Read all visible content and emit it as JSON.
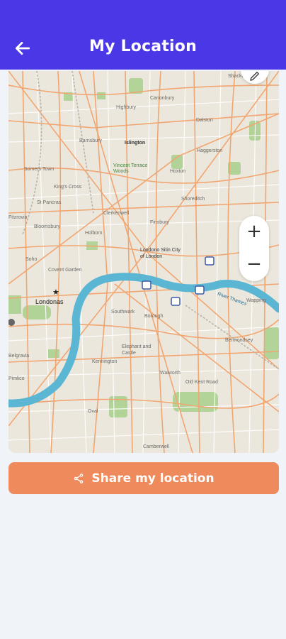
{
  "app_bar": {
    "title": "My Location",
    "back_icon": "arrow-left-icon",
    "background": "#4a38e6"
  },
  "map": {
    "place_labels": [
      {
        "id": "shacklewell",
        "text": "Shacklewell"
      },
      {
        "id": "highbury",
        "text": "Highbury"
      },
      {
        "id": "canonbury",
        "text": "Canonbury"
      },
      {
        "id": "dalston",
        "text": "Dalston"
      },
      {
        "id": "barnsbury",
        "text": "Barnsbury"
      },
      {
        "id": "islington",
        "text": "Islington"
      },
      {
        "id": "haggerston",
        "text": "Haggerston"
      },
      {
        "id": "somers-town",
        "text": "Somers Town"
      },
      {
        "id": "vincent-terrace",
        "text": "Vincent Terrace Woods"
      },
      {
        "id": "hoxton",
        "text": "Hoxton"
      },
      {
        "id": "kings-cross",
        "text": "King's Cross"
      },
      {
        "id": "st-pancras",
        "text": "St Pancras"
      },
      {
        "id": "clerkenwell",
        "text": "Clerkenwell"
      },
      {
        "id": "shoreditch",
        "text": "Shoreditch"
      },
      {
        "id": "fitzrovia",
        "text": "Fitzrovia"
      },
      {
        "id": "bloomsbury",
        "text": "Bloomsbury"
      },
      {
        "id": "finsbury",
        "text": "Finsbury"
      },
      {
        "id": "holborn",
        "text": "Holborn"
      },
      {
        "id": "city-of-london",
        "text": "Londono Sitin City of London"
      },
      {
        "id": "soho",
        "text": "Soho"
      },
      {
        "id": "covent-garden",
        "text": "Covent Garden"
      },
      {
        "id": "londonas",
        "text": "Londonas"
      },
      {
        "id": "southwark",
        "text": "Southwark"
      },
      {
        "id": "borough",
        "text": "Borough"
      },
      {
        "id": "wapping",
        "text": "Wapping"
      },
      {
        "id": "bermondsey",
        "text": "Bermondsey"
      },
      {
        "id": "elephant-castle",
        "text": "Elephant and Castle"
      },
      {
        "id": "kennington",
        "text": "Kennington"
      },
      {
        "id": "walworth",
        "text": "Walworth"
      },
      {
        "id": "old-kent-road",
        "text": "Old Kent Road"
      },
      {
        "id": "pimlico",
        "text": "Pimlico"
      },
      {
        "id": "oval",
        "text": "Oval"
      },
      {
        "id": "camberwell",
        "text": "Camberwell"
      },
      {
        "id": "belgravia",
        "text": "Belgravia"
      },
      {
        "id": "thames",
        "text": "River Thames"
      }
    ],
    "zoom_in_label": "+",
    "zoom_out_label": "−",
    "zoom_in_icon": "plus-icon",
    "zoom_out_icon": "minus-icon",
    "compass_icon": "pencil-icon",
    "marker_icon": "star-icon",
    "colors": {
      "land": "#ece7dc",
      "river": "#5bb6d4",
      "road": "#f1a672",
      "park": "#a8d08d"
    }
  },
  "share": {
    "label": "Share my location",
    "icon": "share-icon",
    "background": "#ee8a5c"
  }
}
